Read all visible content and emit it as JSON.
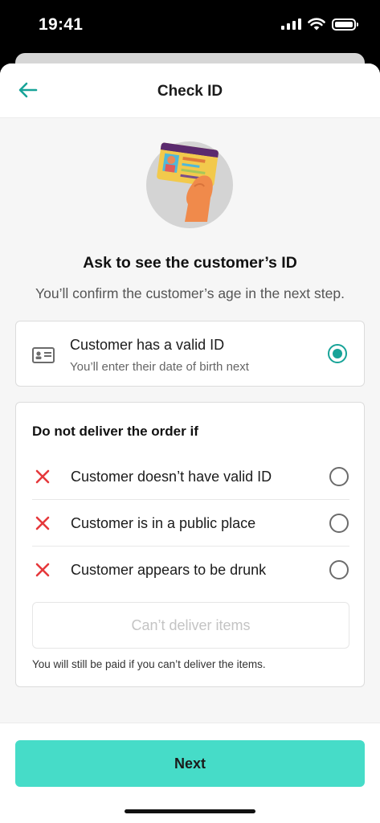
{
  "status_bar": {
    "time": "19:41"
  },
  "header": {
    "title": "Check ID",
    "back_icon": "arrow-left-icon"
  },
  "colors": {
    "accent": "#17a398",
    "primary_button": "#46dcc8",
    "error": "#e5383b"
  },
  "prompt": {
    "heading": "Ask to see the customer’s ID",
    "subheading": "You’ll confirm the customer’s age in the next step."
  },
  "valid_id_option": {
    "title": "Customer has a valid ID",
    "subtitle": "You’ll enter their date of birth next",
    "selected": true
  },
  "do_not_deliver": {
    "title": "Do not deliver the order if",
    "options": [
      {
        "label": "Customer doesn’t have valid ID",
        "selected": false
      },
      {
        "label": "Customer is in a public place",
        "selected": false
      },
      {
        "label": "Customer appears to be drunk",
        "selected": false
      }
    ],
    "cant_deliver_button": "Can’t deliver items",
    "note": "You will still be paid if you can’t deliver the items."
  },
  "footer": {
    "next_button": "Next"
  }
}
